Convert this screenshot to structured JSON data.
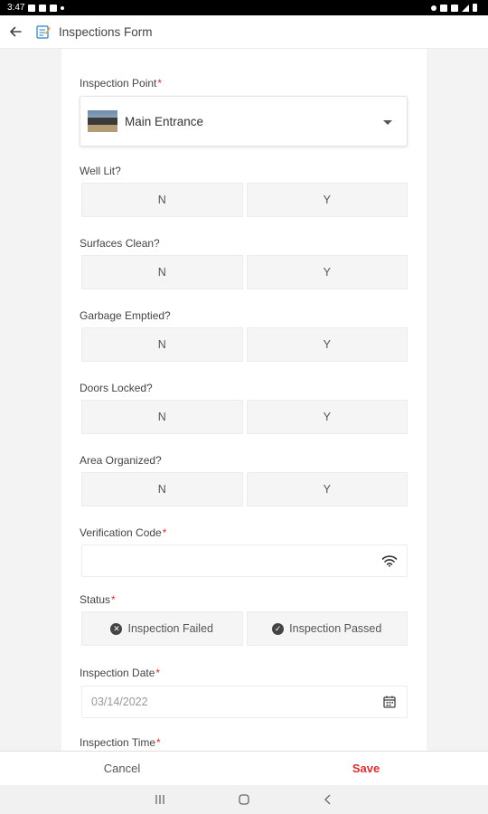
{
  "status_bar": {
    "time": "3:47"
  },
  "app_bar": {
    "title": "Inspections Form",
    "back_icon": "arrow-left-icon",
    "form_icon": "notepad-icon"
  },
  "form": {
    "inspection_point": {
      "label": "Inspection Point",
      "required": "*",
      "value": "Main Entrance"
    },
    "questions": [
      {
        "label": "Well Lit?",
        "options": [
          "N",
          "Y"
        ]
      },
      {
        "label": "Surfaces Clean?",
        "options": [
          "N",
          "Y"
        ]
      },
      {
        "label": "Garbage Emptied?",
        "options": [
          "N",
          "Y"
        ]
      },
      {
        "label": "Doors Locked?",
        "options": [
          "N",
          "Y"
        ]
      },
      {
        "label": "Area Organized?",
        "options": [
          "N",
          "Y"
        ]
      }
    ],
    "verification_code": {
      "label": "Verification Code",
      "required": "*",
      "value": "",
      "icon": "wifi-icon"
    },
    "status": {
      "label": "Status",
      "required": "*",
      "failed": "Inspection Failed",
      "passed": "Inspection Passed"
    },
    "inspection_date": {
      "label": "Inspection Date",
      "required": "*",
      "placeholder": "03/14/2022",
      "icon": "calendar-icon"
    },
    "inspection_time": {
      "label": "Inspection Time",
      "required": "*"
    }
  },
  "actions": {
    "cancel": "Cancel",
    "save": "Save"
  },
  "colors": {
    "accent": "#d32f2f"
  }
}
